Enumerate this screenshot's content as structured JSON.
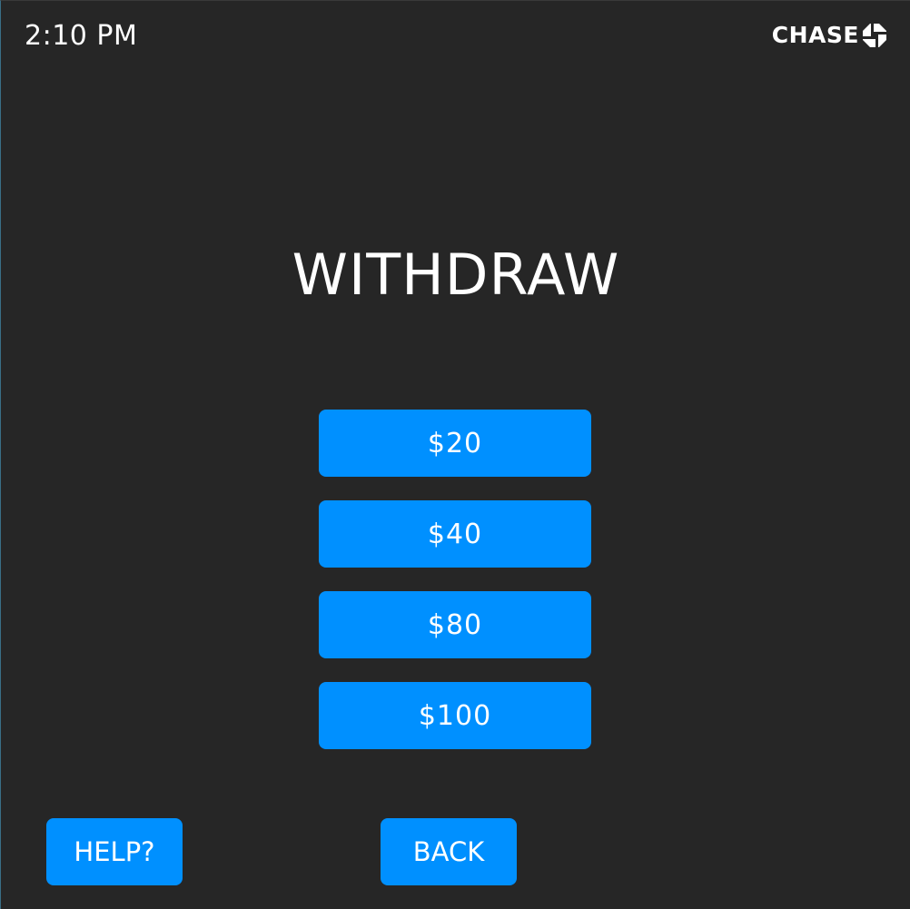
{
  "status_bar": {
    "time": "2:10 PM",
    "brand": "CHASE",
    "brand_icon": "chase-octagon-icon"
  },
  "main": {
    "title": "WITHDRAW",
    "amounts": [
      "$20",
      "$40",
      "$80",
      "$100"
    ]
  },
  "footer": {
    "help_label": "HELP?",
    "back_label": "BACK"
  },
  "colors": {
    "background": "#262626",
    "button": "#0090ff",
    "text": "#ffffff"
  }
}
